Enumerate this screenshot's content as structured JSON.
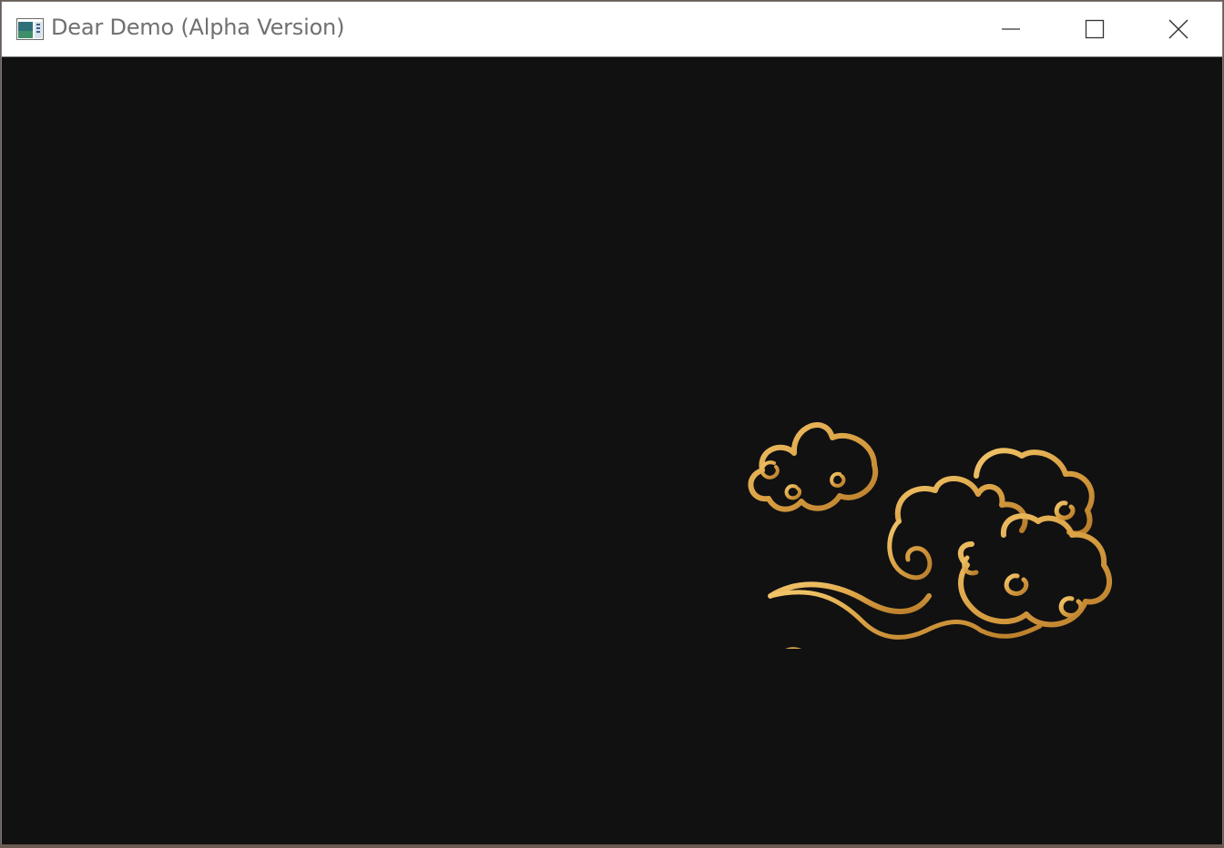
{
  "window": {
    "title": "Dear Demo (Alpha Version)",
    "controls": {
      "minimize_icon": "minimize-icon",
      "maximize_icon": "maximize-icon",
      "close_icon": "close-icon"
    }
  },
  "canvas": {
    "background_color": "#111112",
    "artwork": "gold-cloud-ornament",
    "artwork_color": "#e0a84a"
  }
}
